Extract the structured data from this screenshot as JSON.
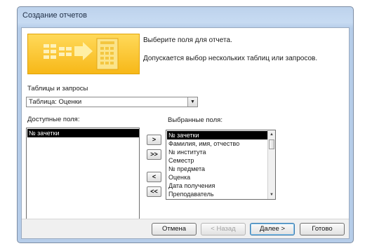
{
  "window": {
    "title": "Создание отчетов"
  },
  "intro": {
    "line1": "Выберите поля для отчета.",
    "line2": "Допускается выбор нескольких таблиц или запросов."
  },
  "tables": {
    "label": "Таблицы и запросы",
    "selected": "Таблица: Оценки"
  },
  "available": {
    "label": "Доступные поля:",
    "items": [
      "№ зачетки"
    ]
  },
  "selected_fields": {
    "label": "Выбранные поля:",
    "items": [
      "№ зачетки",
      "Фамилия, имя, отчество",
      "№ института",
      "Семестр",
      "№ предмета",
      "Оценка",
      "Дата получения",
      "Преподаватель"
    ]
  },
  "move_buttons": {
    "add_one": ">",
    "add_all": ">>",
    "remove_one": "<",
    "remove_all": "<<"
  },
  "footer": {
    "cancel": "Отмена",
    "back": "< Назад",
    "next": "Далее >",
    "finish": "Готово"
  },
  "colors": {
    "selection": "#000000",
    "icon_yellow": "#f7b818",
    "title_bar": "#c7dbf2"
  }
}
